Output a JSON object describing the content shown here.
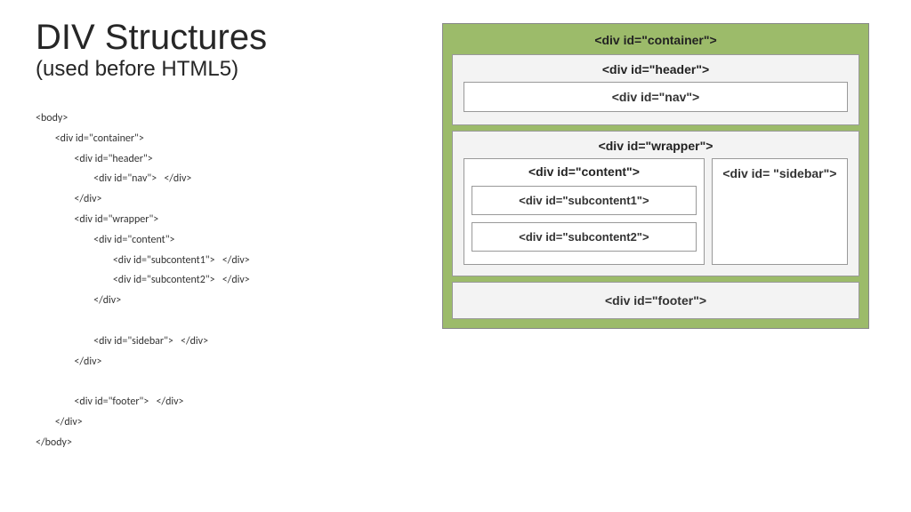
{
  "title": "DIV Structures",
  "subtitle": "(used before HTML5)",
  "code": "<body>\n        <div id=\"container\">\n                <div id=\"header\">\n                        <div id=\"nav\">   </div>\n                </div>\n                <div id=\"wrapper\">\n                        <div id=\"content\">\n                                <div id=\"subcontent1\">   </div>\n                                <div id=\"subcontent2\">   </div>\n                        </div>\n\n                        <div id=\"sidebar\">   </div>\n                </div>\n\n                <div id=\"footer\">   </div>\n        </div>\n</body>",
  "diagram": {
    "container": "<div id=\"container\">",
    "header": "<div id=\"header\">",
    "nav": "<div id=\"nav\">",
    "wrapper": "<div id=\"wrapper\">",
    "content": "<div id=\"content\">",
    "subcontent1": "<div id=\"subcontent1\">",
    "subcontent2": "<div id=\"subcontent2\">",
    "sidebar": "<div id= \"sidebar\">",
    "footer": "<div id=\"footer\">"
  }
}
